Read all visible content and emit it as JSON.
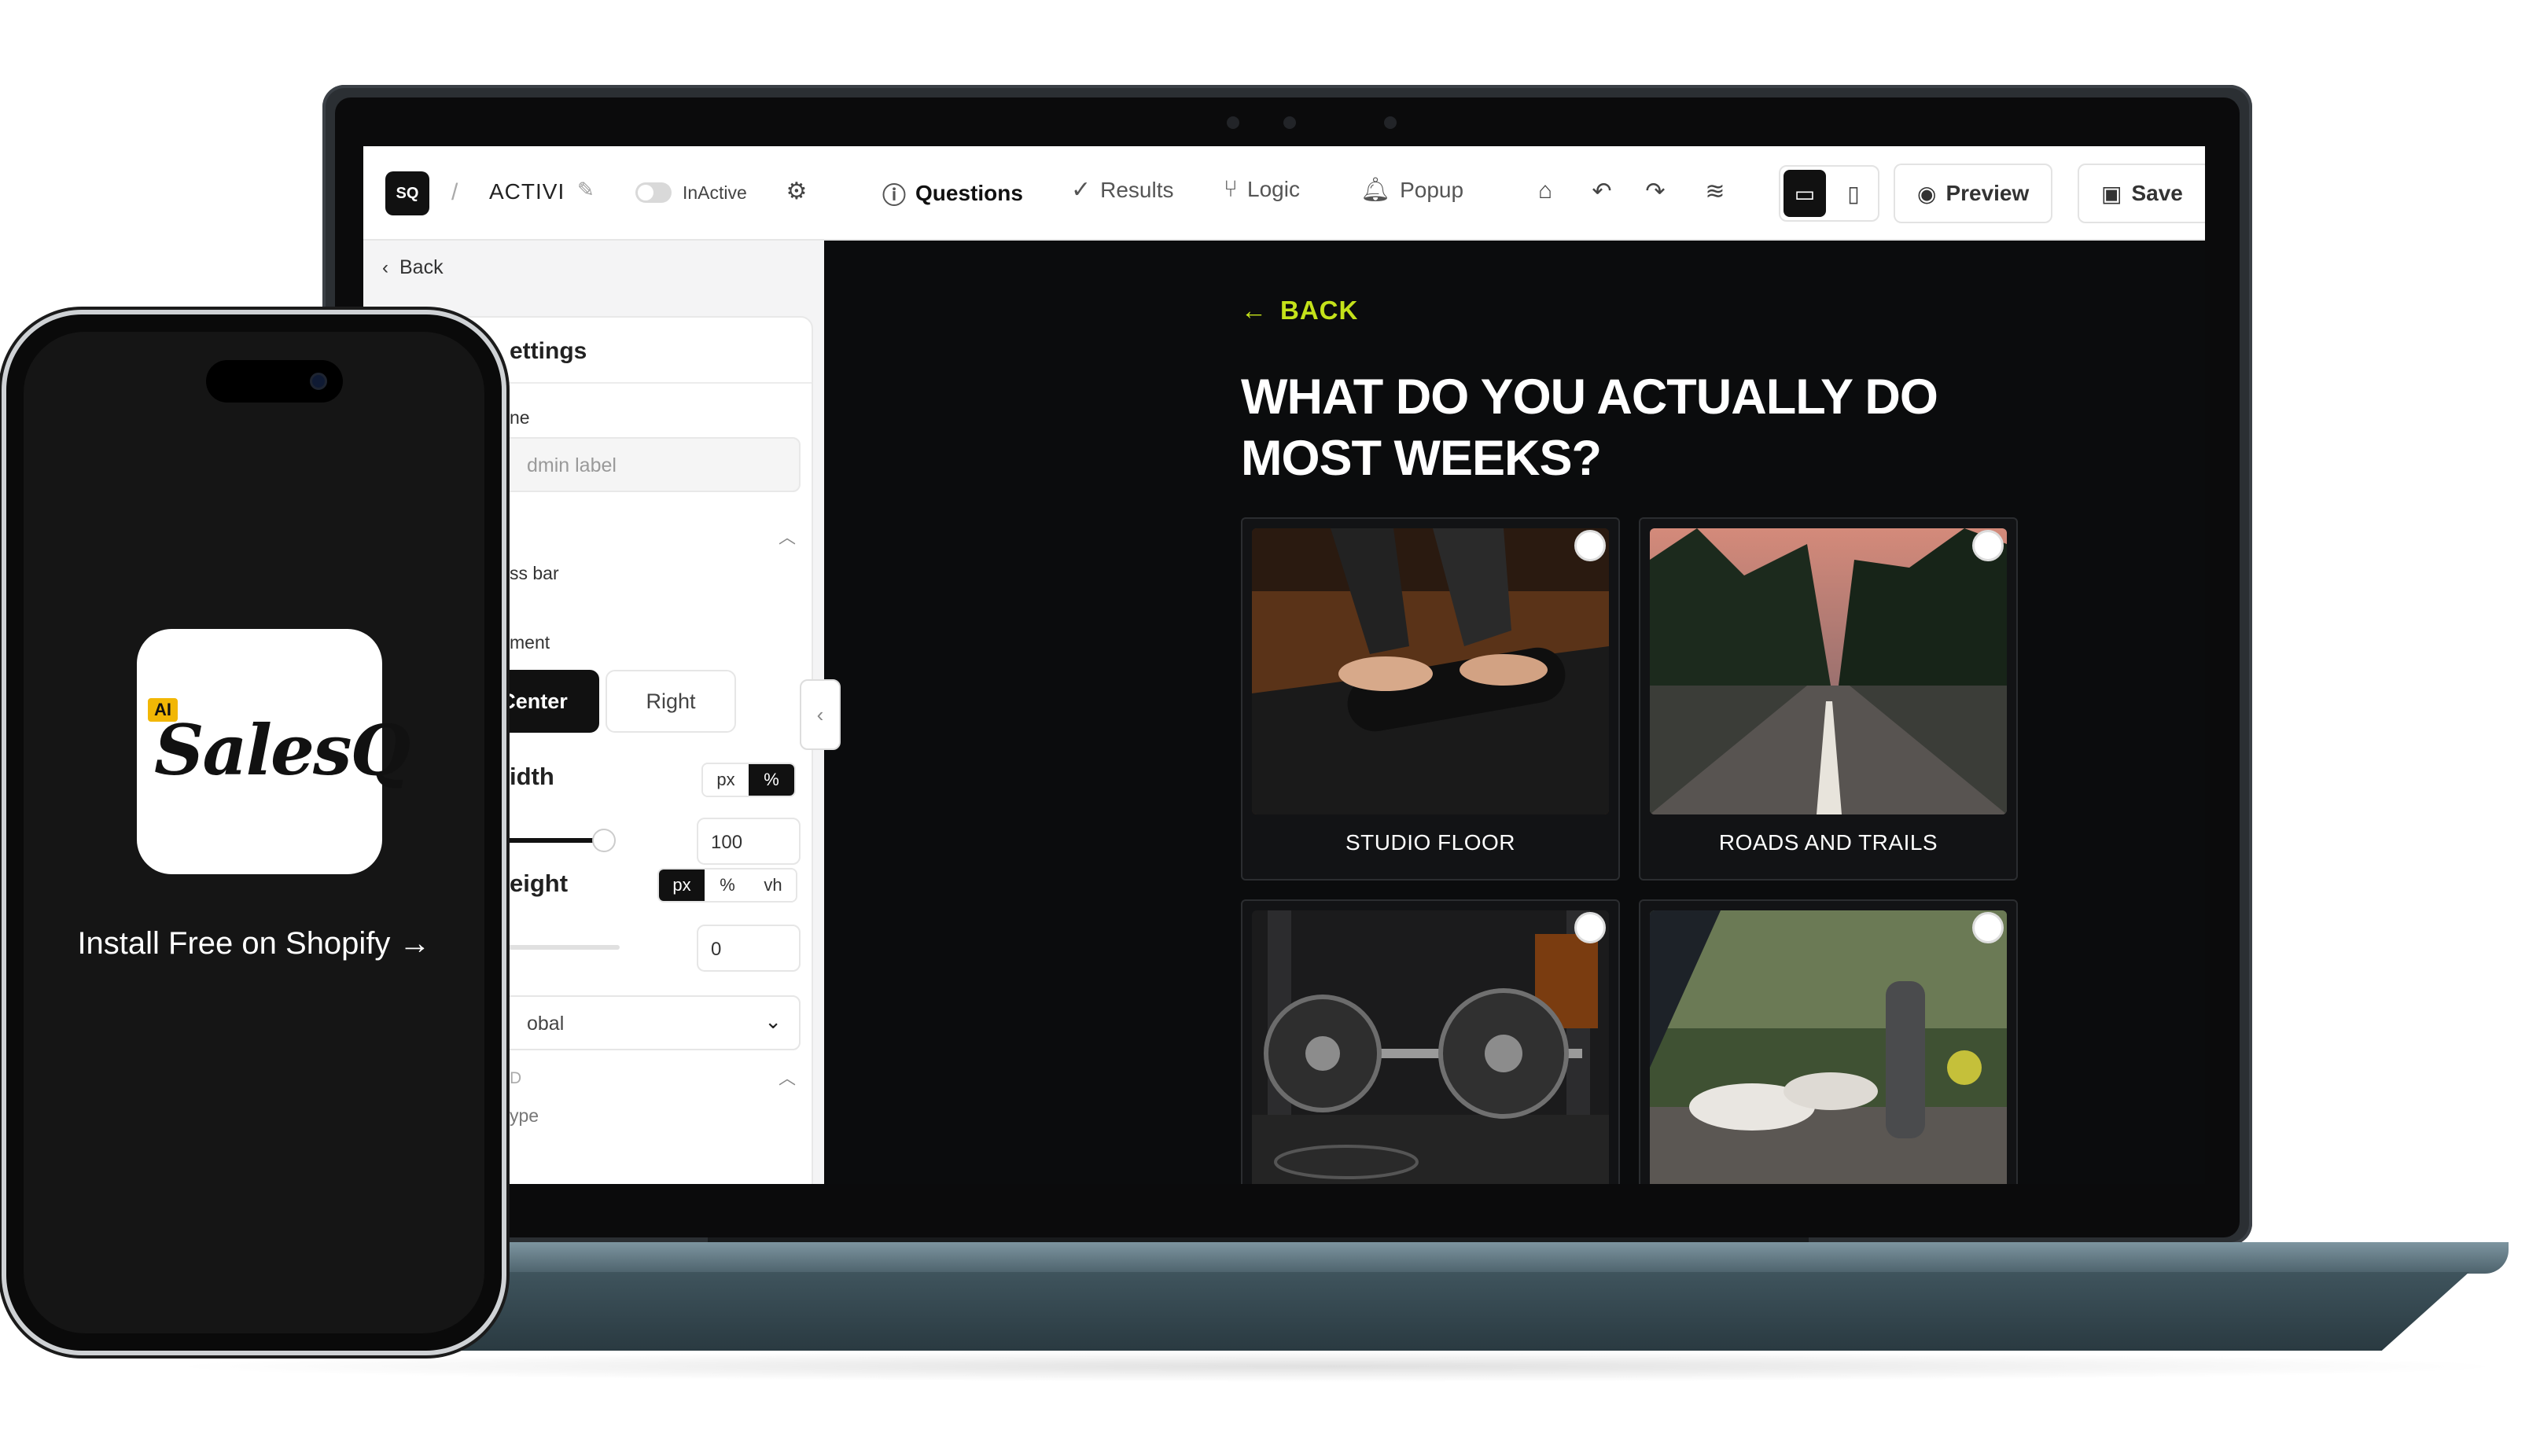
{
  "topbar": {
    "logo": "SQ",
    "separator": "/",
    "quiz_title": "ACTIVI",
    "status_label": "InActive",
    "nav": [
      {
        "label": "Questions",
        "icon": "question-circle-icon",
        "active": true
      },
      {
        "label": "Results",
        "icon": "check-circle-icon",
        "active": false
      },
      {
        "label": "Logic",
        "icon": "branch-icon",
        "active": false
      },
      {
        "label": "Popup",
        "icon": "bell-icon",
        "active": false
      }
    ],
    "tools": [
      "tag-icon",
      "undo-icon",
      "redo-icon",
      "layers-icon"
    ],
    "devices": [
      {
        "icon": "desktop-icon",
        "selected": true
      },
      {
        "icon": "mobile-icon",
        "selected": false
      }
    ],
    "preview_label": "Preview",
    "save_label": "Save"
  },
  "sidebar": {
    "back_label": "Back",
    "panel_title": "ettings",
    "name_label": "ne",
    "name_placeholder": "dmin label",
    "progress_label": "ss bar",
    "alignment_label": "ment",
    "alignment_options": [
      "Center",
      "Right"
    ],
    "alignment_selected": "Center",
    "width_label": "idth",
    "width_units": [
      "px",
      "%"
    ],
    "width_unit_selected": "%",
    "width_value": "100",
    "width_level": 1.0,
    "height_label": "eight",
    "height_units": [
      "px",
      "%",
      "vh"
    ],
    "height_unit_selected": "px",
    "height_value": "0",
    "height_level": 0.0,
    "select_value": "obal",
    "section_label": "D",
    "type_label": "ype"
  },
  "preview": {
    "back_label": "BACK",
    "question": "WHAT DO YOU ACTUALLY DO MOST WEEKS?",
    "options": [
      {
        "label": "STUDIO FLOOR"
      },
      {
        "label": "ROADS AND TRAILS"
      },
      {
        "label": ""
      },
      {
        "label": ""
      }
    ]
  },
  "phone": {
    "badge": "AI",
    "brand": "SalesQ",
    "cta": "Install Free on Shopify →"
  },
  "colors": {
    "accent": "#c4e21a",
    "preview_bg": "#0b0c0d",
    "laptop_base": "#4d626c"
  }
}
